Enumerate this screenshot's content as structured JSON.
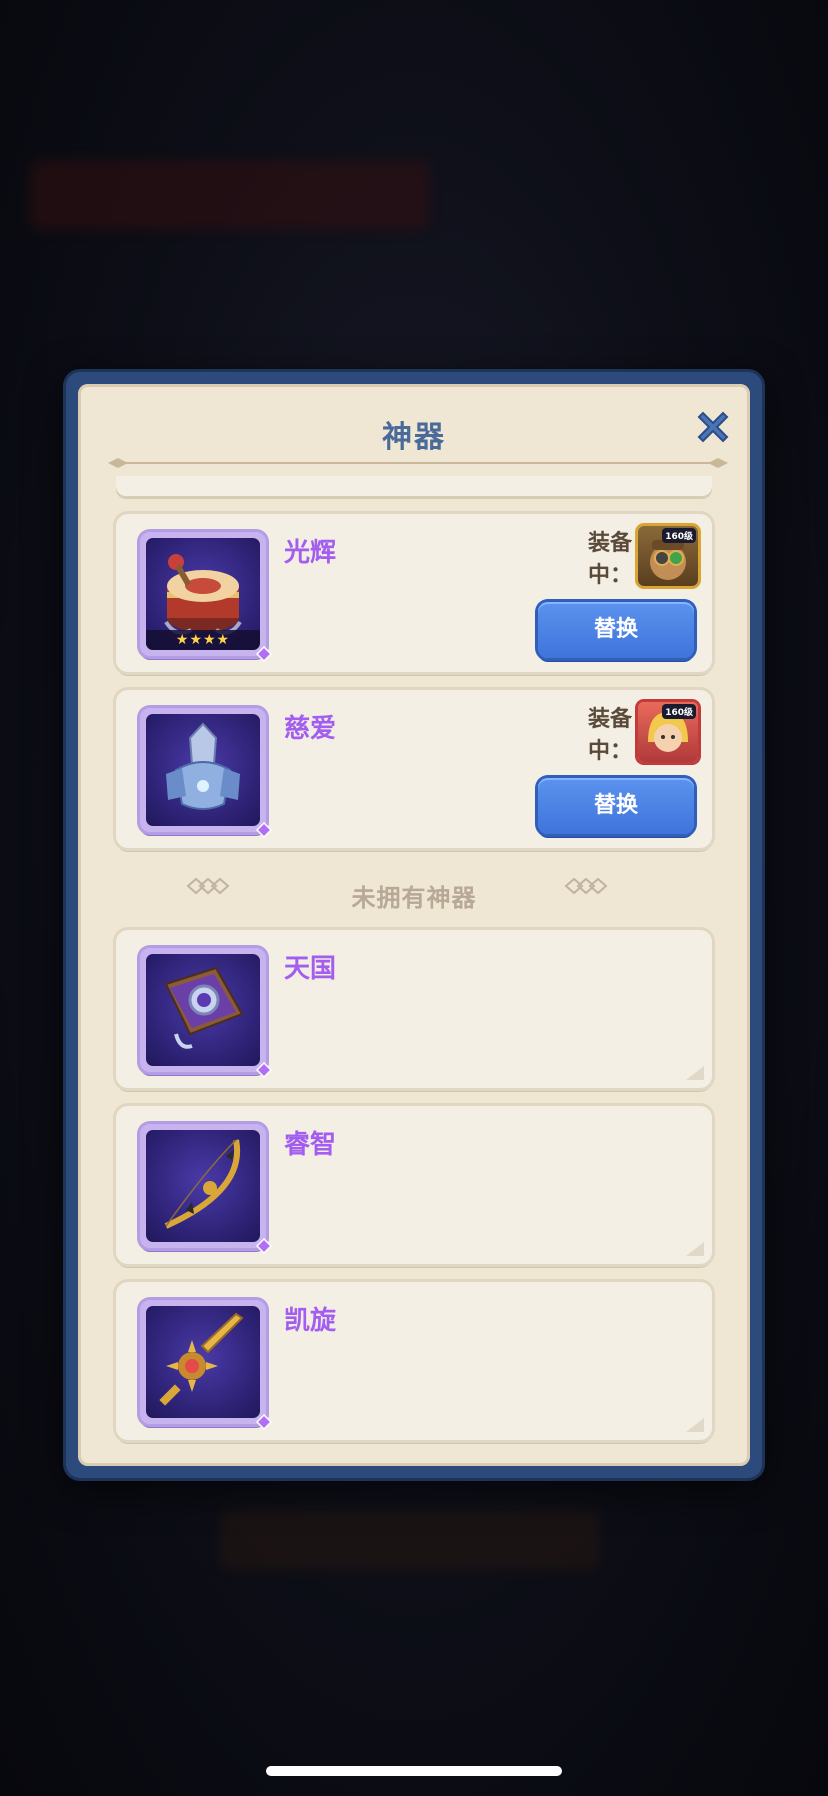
{
  "dialog": {
    "title": "神器",
    "close_icon": "close-x-icon"
  },
  "owned_artifacts": [
    {
      "name": "光辉",
      "icon": "drum-artifact-icon",
      "stars": "★★★★",
      "equip_label": "装备中：",
      "hero_level": "160级",
      "hero_icon": "goggle-hero-avatar",
      "button_label": "替换"
    },
    {
      "name": "慈爱",
      "icon": "armor-artifact-icon",
      "equip_label": "装备中：",
      "hero_level": "160级",
      "hero_icon": "blonde-hero-avatar",
      "button_label": "替换"
    }
  ],
  "unowned_section": {
    "title": "未拥有神器"
  },
  "unowned_artifacts": [
    {
      "name": "天国",
      "icon": "tome-artifact-icon"
    },
    {
      "name": "睿智",
      "icon": "bow-artifact-icon"
    },
    {
      "name": "凯旋",
      "icon": "sword-artifact-icon"
    }
  ],
  "colors": {
    "frame_blue": "#2d4a7c",
    "panel_bg": "#efe6d3",
    "card_bg": "#f4efe5",
    "artifact_name": "#a35ef0",
    "button_blue": "#4a82e6",
    "title_blue": "#4a6a9a"
  }
}
